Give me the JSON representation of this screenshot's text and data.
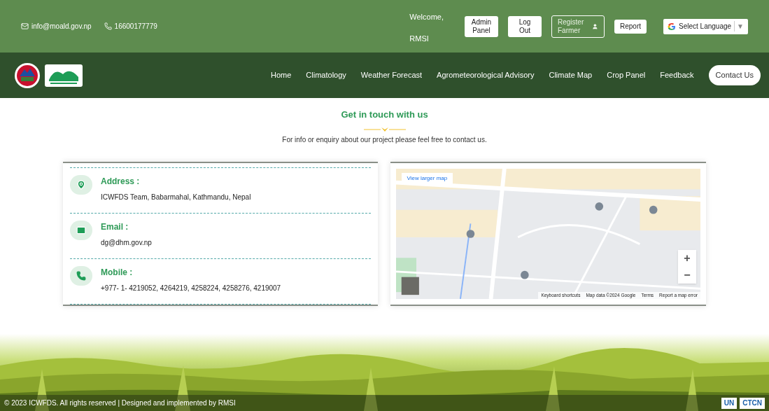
{
  "top_bar": {
    "email": "info@moald.gov.np",
    "phone": "16600177779",
    "welcome": "Welcome,",
    "user": "RMSI",
    "buttons": [
      {
        "label": "Admin Panel",
        "kind": "solid"
      },
      {
        "label": "Log Out",
        "kind": "solid"
      },
      {
        "label": "Register Farmer",
        "kind": "outline"
      },
      {
        "label": "Report",
        "kind": "solid"
      }
    ],
    "language": {
      "label": "Select Language",
      "arrow": "▼"
    }
  },
  "nav": {
    "items": [
      {
        "label": "Home",
        "selected": false
      },
      {
        "label": "Climatology",
        "selected": false
      },
      {
        "label": "Weather Forecast",
        "selected": false
      },
      {
        "label": "Agrometeorological Advisory",
        "selected": false
      },
      {
        "label": "Climate Map",
        "selected": false
      },
      {
        "label": "Crop Panel",
        "selected": false
      },
      {
        "label": "Feedback",
        "selected": false
      },
      {
        "label": "Contact Us",
        "selected": true
      }
    ]
  },
  "heading": {
    "title": "Get in touch with us",
    "subtitle": "For info or enquiry about our project please feel free to contact us."
  },
  "contacts": [
    {
      "kind": "address",
      "label": "Address :",
      "value": "ICWFDS Team, Babarmahal, Kathmandu, Nepal"
    },
    {
      "kind": "email",
      "label": "Email :",
      "value": "dg@dhm.gov.np"
    },
    {
      "kind": "phone",
      "label": "Mobile :",
      "value": "+977- 1- 4219052, 4264219, 4258224, 4258276, 4219007"
    }
  ],
  "map": {
    "kind": "picture",
    "link": "View larger map",
    "zoom_in": "+",
    "zoom_out": "−",
    "footer_links": [
      "Keyboard shortcuts",
      "Map data ©2024 Google",
      "Terms",
      "Report a map error"
    ]
  },
  "footer": {
    "text": "© 2023 ICWFDS. All rights reserved | Designed and implemented by RMSI",
    "logos": [
      "UN",
      "CTCN"
    ]
  }
}
